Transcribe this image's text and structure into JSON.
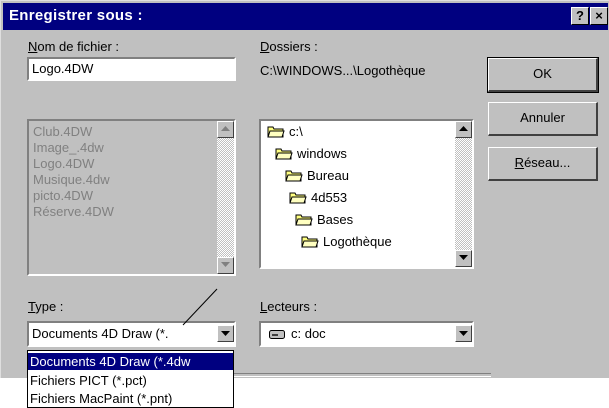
{
  "dialog": {
    "title": "Enregistrer sous :",
    "help_button": "?",
    "close_button": "×"
  },
  "filename": {
    "label": "Nom de fichier :",
    "value": "Logo.4DW",
    "files": [
      "Club.4DW",
      "Image_.4dw",
      "Logo.4DW",
      "Musique.4dw",
      "picto.4DW",
      "Réserve.4DW"
    ]
  },
  "folders": {
    "label": "Dossiers :",
    "path": "C:\\WINDOWS...\\Logothèque",
    "tree": [
      "c:\\",
      "windows",
      "Bureau",
      "4d553",
      "Bases",
      "Logothèque"
    ]
  },
  "buttons": {
    "ok": "OK",
    "cancel": "Annuler",
    "network": "Réseau..."
  },
  "type": {
    "label": "Type :",
    "value": "Documents 4D Draw (*.",
    "options": [
      "Documents 4D Draw (*.4dw",
      "Fichiers PICT (*.pct)",
      "Fichiers MacPaint (*.pnt)"
    ]
  },
  "drives": {
    "label": "Lecteurs :",
    "value": "c: doc"
  }
}
